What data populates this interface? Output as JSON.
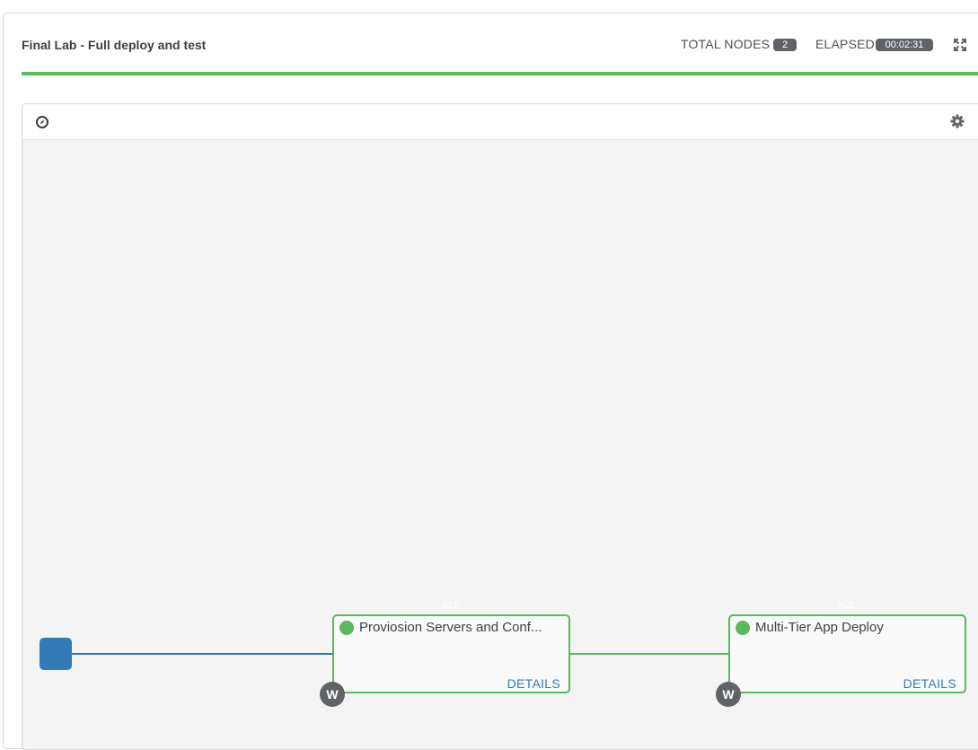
{
  "header": {
    "title": "Final Lab - Full deploy and test",
    "total_nodes_label": "TOTAL NODES",
    "total_nodes_value": "2",
    "elapsed_label": "ELAPSED",
    "elapsed_value": "00:02:31"
  },
  "progress": {
    "percent": 100,
    "color": "#5cb85c"
  },
  "toolbar": {
    "left_icon": "compass-icon",
    "right_icon": "gear-icon"
  },
  "workflow": {
    "nodes": [
      {
        "name": "Proviosion Servers and Conf...",
        "details": "DETAILS",
        "badge": "W",
        "edge_label": "ALL",
        "status": "success"
      },
      {
        "name": "Multi-Tier App Deploy",
        "details": "DETAILS",
        "badge": "W",
        "edge_label": "ALL",
        "status": "success"
      }
    ]
  },
  "colors": {
    "success": "#5cb85c",
    "start": "#337ab7",
    "badge": "#5f6368",
    "link": "#337ab7"
  }
}
